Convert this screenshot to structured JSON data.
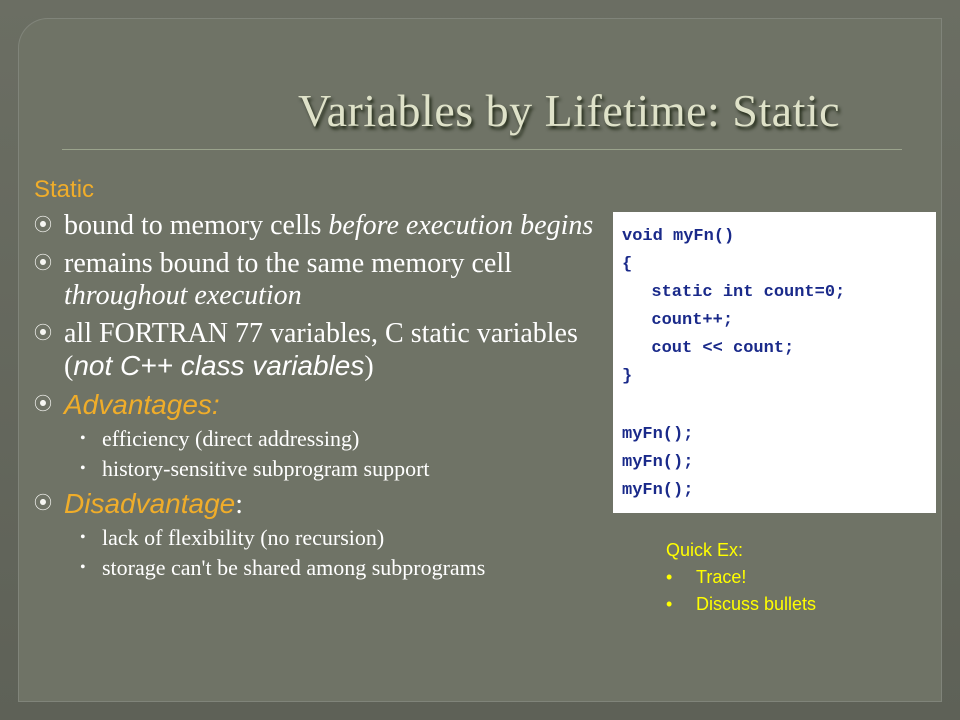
{
  "slide": {
    "title": "Variables by Lifetime: Static",
    "heading": "Static",
    "bullets": [
      {
        "text_a": "bound to memory cells ",
        "text_b": "before execution begins"
      },
      {
        "text_a": "remains bound to the same memory cell ",
        "text_b": "throughout execution"
      },
      {
        "text_a": "all FORTRAN 77 variables, C static variables (",
        "text_b": "not C++ class variables",
        "text_c": ")"
      },
      {
        "label": "Advantages:",
        "subs": [
          "efficiency  (direct addressing)",
          "history-sensitive subprogram support"
        ]
      },
      {
        "label": "Disadvantage",
        "colon": ":",
        "subs": [
          "lack of flexibility  (no recursion)",
          "storage can't be shared among subprograms"
        ]
      }
    ],
    "bullet_mark": "⦿",
    "sub_mark": "•"
  },
  "code": {
    "lines": [
      "void myFn()",
      "{",
      "  static int count=0;",
      "  count++;",
      "  cout << count;",
      "}",
      "",
      "myFn();",
      "myFn();",
      "myFn();"
    ]
  },
  "quick_ex": {
    "title": "Quick Ex:",
    "items": [
      "Trace!",
      "Discuss bullets"
    ]
  },
  "colors": {
    "background": "#6f7366",
    "accent": "#f0ad2a",
    "title": "#dfe2c9",
    "code": "#1a2a8a",
    "quick": "#ffff00"
  }
}
